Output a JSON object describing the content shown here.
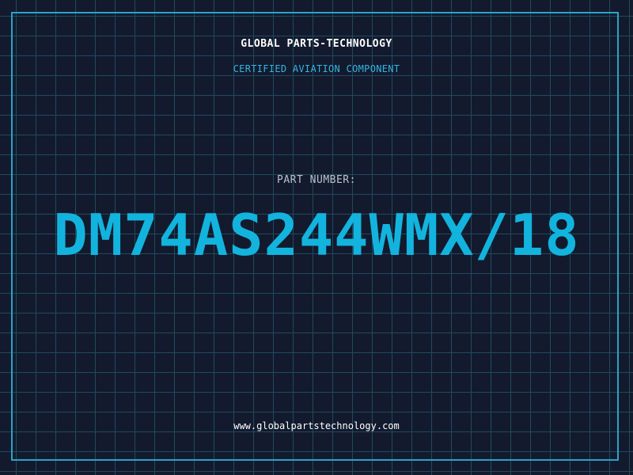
{
  "header": {
    "company_name": "GLOBAL PARTS-TECHNOLOGY",
    "tagline": "CERTIFIED AVIATION COMPONENT"
  },
  "part": {
    "label": "PART NUMBER:",
    "number": "DM74AS244WMX/18"
  },
  "footer": {
    "website": "www.globalpartstechnology.com"
  },
  "colors": {
    "background": "#131a2e",
    "grid": "#1f4a5e",
    "accent": "#12b4de",
    "frame": "#2aa3c9"
  }
}
